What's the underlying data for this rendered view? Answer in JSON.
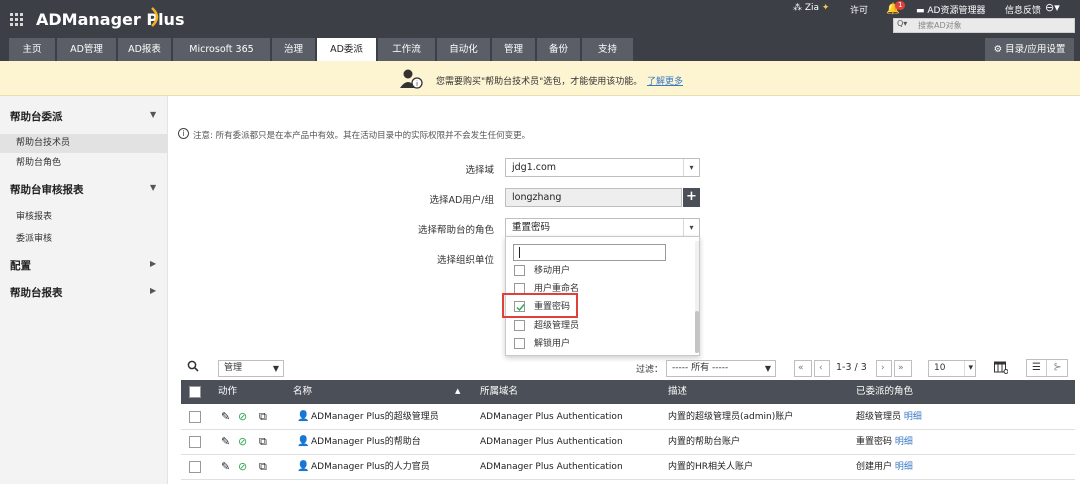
{
  "app": {
    "title": "ADManager Plus"
  },
  "topbar": {
    "zia": "Zia",
    "license": "许可",
    "notification_count": "1",
    "ad_manager": "AD资源管理器",
    "feedback": "信息反馈",
    "search_placeholder": "搜索AD对象"
  },
  "tabs": [
    "主页",
    "AD管理",
    "AD报表",
    "Microsoft 365",
    "治理",
    "AD委派",
    "工作流",
    "自动化",
    "管理",
    "备份",
    "支持"
  ],
  "tabs_active": "AD委派",
  "directory_settings": "目录/应用设置",
  "banner": {
    "message": "您需要购买\"帮助台技术员\"选包，才能使用该功能。",
    "link": "了解更多"
  },
  "sidebar": {
    "sec1": "帮助台委派",
    "sec1_items": [
      "帮助台技术员",
      "帮助台角色"
    ],
    "sec2": "帮助台审核报表",
    "sec2_items": [
      "审核报表",
      "委派审核"
    ],
    "sec3": "配置",
    "sec4": "帮助台报表"
  },
  "notice": "注意: 所有委派都只是在本产品中有效。其在活动目录中的实际权限并不会发生任何变更。",
  "form": {
    "domain_label": "选择域",
    "domain_value": "jdg1.com",
    "user_label": "选择AD用户/组",
    "user_value": "longzhang",
    "role_label": "选择帮助台的角色",
    "role_value": "重置密码",
    "ou_label": "选择组织单位"
  },
  "dropdown": {
    "search_value": "",
    "options": [
      {
        "label": "移动用户",
        "checked": false
      },
      {
        "label": "用户重命名",
        "checked": false
      },
      {
        "label": "重置密码",
        "checked": true
      },
      {
        "label": "超级管理员",
        "checked": false
      },
      {
        "label": "解锁用户",
        "checked": false
      }
    ]
  },
  "toolbar": {
    "manage": "管理",
    "filter_label": "过滤：",
    "filter_value": "----- 所有 -----",
    "pager": "1-3 / 3",
    "page_size": "10"
  },
  "table": {
    "headers": [
      "动作",
      "名称",
      "所属域名",
      "描述",
      "已委派的角色"
    ],
    "detail_link": "明细",
    "rows": [
      {
        "name": "ADManager Plus的超级管理员",
        "domain": "ADManager Plus Authentication",
        "desc": "内置的超级管理员(admin)账户",
        "role": "超级管理员"
      },
      {
        "name": "ADManager Plus的帮助台",
        "domain": "ADManager Plus Authentication",
        "desc": "内置的帮助台账户",
        "role": "重置密码"
      },
      {
        "name": "ADManager Plus的人力官员",
        "domain": "ADManager Plus Authentication",
        "desc": "内置的HR相关人账户",
        "role": "创建用户"
      }
    ]
  },
  "colors": {
    "header_bg": "#3c3f46",
    "banner_bg": "#fdf4d2",
    "highlight": "#e0403a",
    "check_green": "#2aa84a",
    "link": "#3b7ac4"
  }
}
